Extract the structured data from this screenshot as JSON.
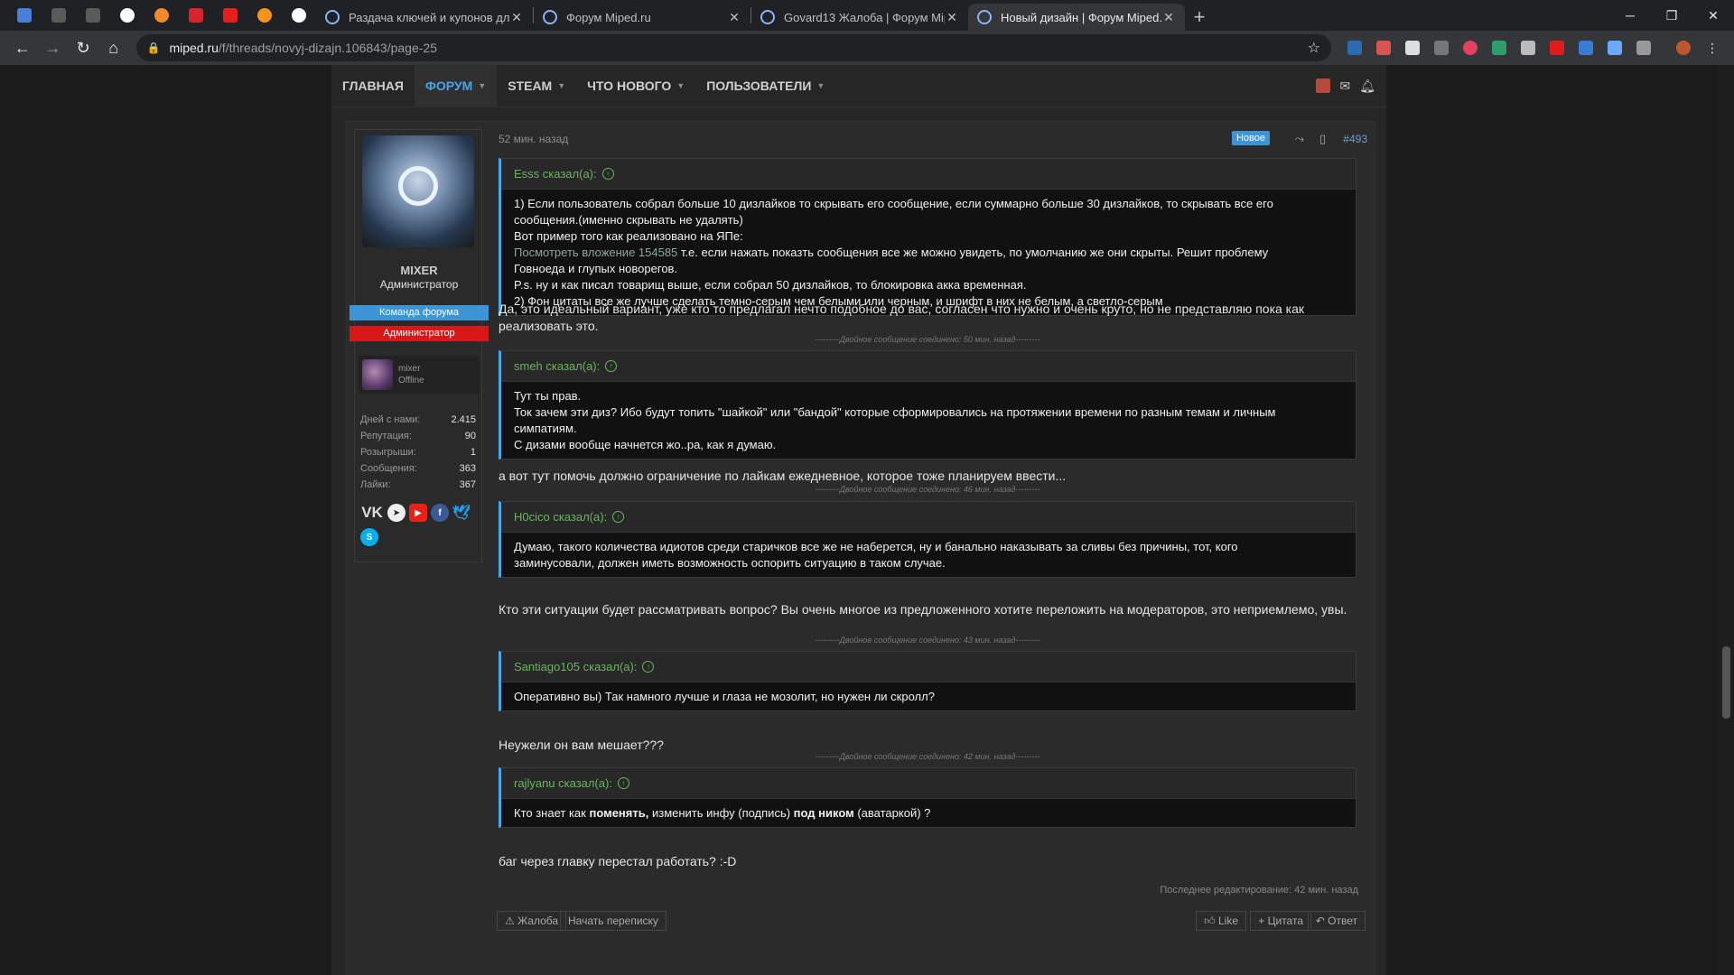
{
  "browser": {
    "tabs": [
      {
        "title": "Раздача ключей и купонов для"
      },
      {
        "title": "Форум Miped.ru"
      },
      {
        "title": "Govard13 Жалоба | Форум Mipe"
      },
      {
        "title": "Новый дизайн | Форум Miped.ru"
      }
    ],
    "url_host": "miped.ru",
    "url_path": "/f/threads/novyj-dizajn.106843/page-25"
  },
  "forum_nav": {
    "items": [
      {
        "label": "ГЛАВНАЯ"
      },
      {
        "label": "ФОРУМ"
      },
      {
        "label": "STEAM"
      },
      {
        "label": "ЧТО НОВОГО"
      },
      {
        "label": "ПОЛЬЗОВАТЕЛИ"
      }
    ]
  },
  "user": {
    "name": "MIXER",
    "title": "Администратор",
    "banner1": "Команда форума",
    "banner2": "Администратор",
    "mini_name": "mixer",
    "mini_status": "Offline",
    "stats": [
      {
        "label": "Дней с нами:",
        "value": "2.415"
      },
      {
        "label": "Репутация:",
        "value": "90"
      },
      {
        "label": "Розыгрыши:",
        "value": "1"
      },
      {
        "label": "Сообщения:",
        "value": "363"
      },
      {
        "label": "Лайки:",
        "value": "367"
      }
    ],
    "vk_label": "VK"
  },
  "post": {
    "time": "52 мин. назад",
    "new_badge": "Новое",
    "number": "#493",
    "quote1": {
      "author": "Esss сказал(а):",
      "lines": [
        "1) Если пользователь собрал больше 10 дизлайков то скрывать его сообщение, если суммарно больше 30 дизлайков, то скрывать все его",
        "сообщения.(именно скрывать не удалять)",
        "Вот пример того как реализовано на ЯПе:"
      ],
      "attach": "Посмотреть вложение 154585",
      "attach_rest": " т.е. если нажать показть сообщения все же можно увидеть, по умолчанию же они скрыты. Решит проблему",
      "lines2": [
        "Говноеда и глупых новорегов.",
        "P.s. ну и как писал товарищ выше, если собрал 50 дизлайков, то блокировка акка временная.",
        "2) Фон цитаты все же лучше сделать темно-серым чем белыми или черным, и шрифт в них не белым, а светло-серым"
      ]
    },
    "reply1": "Да, это идеальный вариант, уже кто то предлагал нечто подобное до вас, согласен что нужно и очень круто, но не представляю пока как реализовать это.",
    "merge1": "---------Двойное сообщение соединено: 50 мин. назад---------",
    "quote2": {
      "author": "smeh сказал(а):",
      "lines": [
        "Тут ты прав.",
        "Ток зачем эти диз? Ибо будут топить \"шайкой\" или \"бандой\" которые сформировались на протяжении времени по разным темам и личным",
        "симпатиям.",
        "С дизами вообще начнется жо..ра, как я думаю."
      ]
    },
    "reply2": "а вот тут помочь должно ограничение по лайкам ежедневное, которое тоже планируем ввести...",
    "merge2": "---------Двойное сообщение соединено: 46 мин. назад---------",
    "quote3": {
      "author": "H0cico сказал(а):",
      "lines": [
        "Думаю, такого количества идиотов среди старичков все же не наберется, ну и банально наказывать за сливы без причины, тот, кого",
        "заминусовали, должен иметь возможность оспорить ситуацию в таком случае."
      ]
    },
    "reply3": "Кто эти ситуации будет рассматривать вопрос? Вы очень многое из предложенного хотите переложить на модераторов, это неприемлемо, увы.",
    "merge3": "---------Двойное сообщение соединено: 43 мин. назад---------",
    "quote4": {
      "author": "Santiago105 сказал(а):",
      "lines": [
        "Оперативно вы) Так намного лучше и глаза не мозолит, но нужен ли скролл?"
      ]
    },
    "reply4": "Неужели он вам мешает???",
    "merge4": "---------Двойное сообщение соединено: 42 мин. назад---------",
    "quote5": {
      "author": "rajlyanu сказал(а):",
      "p1": "Кто знает как ",
      "b1": "поменять,",
      "p2": " изменить инфу (подпись) ",
      "b2": "под ником",
      "p3": " (аватаркой) ?"
    },
    "reply5": "баг через главку перестал работать? :-D",
    "last_edit": "Последнее редактирование: 42 мин. назад",
    "actions": {
      "report": "Жалоба",
      "start_convo": "Начать переписку",
      "like": "Like",
      "quote": "Цитата",
      "reply": "Ответ"
    }
  },
  "colors": {
    "accent": "#47a7eb",
    "quote_author": "#6bb35f",
    "banner_blue": "#3c95d6",
    "banner_red": "#d81818"
  }
}
